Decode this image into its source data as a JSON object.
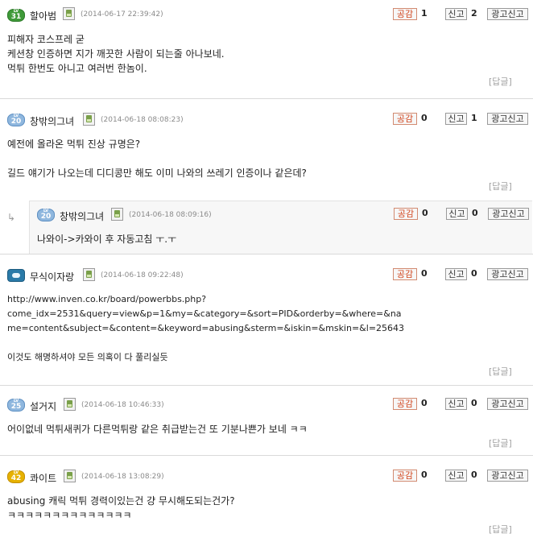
{
  "labels": {
    "like": "공감",
    "report": "신고",
    "ad_report": "광고신고",
    "reply": "[답글]"
  },
  "comments": [
    {
      "level": "31",
      "username": "할아범",
      "date": "(2014-06-17 22:39:42)",
      "likes": "1",
      "reports": "2",
      "body": "피해자 코스프레 굳\n케션창 인증하면 지가 깨끗한 사람이 되는줄 아나보네.\n먹튀 한번도 아니고 여러번 한놈이."
    },
    {
      "level": "20",
      "username": "창밖의그녀",
      "date": "(2014-06-18 08:08:23)",
      "likes": "0",
      "reports": "1",
      "body": "예전에 올라온 먹튀 진상 규명은?\n\n길드 얘기가 나오는데 디디콩만 해도 이미 나와의 쓰레기 인증이나 같은데?",
      "reply_arrow": "↳",
      "nested": {
        "level": "20",
        "username": "창밖의그녀",
        "date": "(2014-06-18 08:09:16)",
        "likes": "0",
        "reports": "0",
        "body": "나와이->카와이 후 자동고침 ㅜ.ㅜ"
      }
    },
    {
      "level": "",
      "username": "무식이자랑",
      "date": "(2014-06-18 09:22:48)",
      "likes": "0",
      "reports": "0",
      "body": "http://www.inven.co.kr/board/powerbbs.php?\ncome_idx=2531&query=view&p=1&my=&category=&sort=PID&orderby=&where=&na\nme=content&subject=&content=&keyword=abusing&sterm=&iskin=&mskin=&l=25643\n\n이것도 해명하셔야 모든 의혹이 다 풀리실듯"
    },
    {
      "level": "25",
      "username": "설거지",
      "date": "(2014-06-18 10:46:33)",
      "likes": "0",
      "reports": "0",
      "body": "어이없네 먹튀새퀴가 다른먹튀랑 같은 취급받는건 또 기분나쁜가 보네 ㅋㅋ"
    },
    {
      "level": "42",
      "username": "콰이트",
      "date": "(2014-06-18 13:08:29)",
      "likes": "0",
      "reports": "0",
      "body": "abusing 캐릭 먹튀 경력이있는건 걍 무시해도되는건가?\nㅋㅋㅋㅋㅋㅋㅋㅋㅋㅋㅋㅋㅋㅋ"
    }
  ]
}
